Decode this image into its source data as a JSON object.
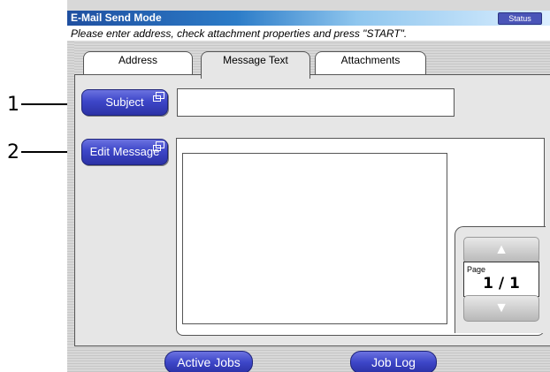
{
  "callouts": [
    "1",
    "2"
  ],
  "header": {
    "title": "E-Mail Send Mode",
    "status_label": "Status",
    "instruction": "Please enter address, check attachment properties and press \"START\"."
  },
  "tabs": [
    {
      "label": "Address",
      "active": false
    },
    {
      "label": "Message Text",
      "active": true
    },
    {
      "label": "Attachments",
      "active": false
    }
  ],
  "form": {
    "subject_label": "Subject",
    "subject_value": "",
    "edit_message_label": "Edit Message",
    "message_value": ""
  },
  "pager": {
    "label": "Page",
    "value": "1 / 1",
    "up_icon": "double-chevron-up-icon",
    "down_icon": "double-chevron-down-icon"
  },
  "footer": {
    "active_jobs_label": "Active Jobs",
    "job_log_label": "Job Log"
  },
  "colors": {
    "accent": "#3d46c8",
    "titlebar": "#1f4fa0"
  }
}
